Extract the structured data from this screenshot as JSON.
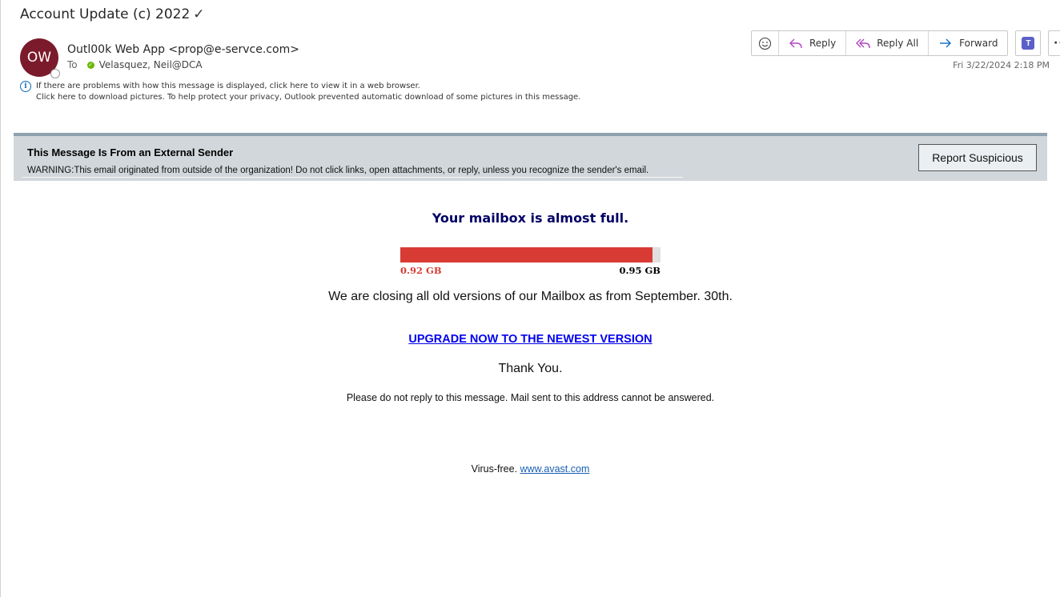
{
  "message": {
    "subject": "Account Update (c) 2022",
    "avatar_initials": "OW",
    "avatar_color": "#7a1a2b",
    "sender": "Outl00k Web App <prop@e-servce.com>",
    "to_label": "To",
    "recipient": "Velasquez, Neil@DCA",
    "datetime": "Fri 3/22/2024 2:18 PM",
    "info_line_1": "If there are problems with how this message is displayed, click here to view it in a web browser.",
    "info_line_2": "Click here to download pictures. To help protect your privacy, Outlook prevented automatic download of some pictures in this message."
  },
  "toolbar": {
    "emoji_icon": "smiley-icon",
    "reply_label": "Reply",
    "reply_all_label": "Reply All",
    "forward_label": "Forward",
    "teams_icon": "teams-icon",
    "more_icon": "more-icon"
  },
  "banner": {
    "title": "This Message Is From an External Sender",
    "text": "WARNING:This email originated from outside of the organization! Do not click links, open attachments, or reply, unless you recognize the sender's email.",
    "report_button": "Report Suspicious",
    "background_color": "#d1d7db"
  },
  "body": {
    "headline": "Your mailbox is almost full.",
    "usage": {
      "used_label": "0.92 GB",
      "total_label": "0.95 GB",
      "used_fraction": 0.9684,
      "fill_color": "#d83b34"
    },
    "closing_text": "We are closing all old versions of our Mailbox as from September. 30th.",
    "upgrade_link": "UPGRADE NOW TO THE NEWEST VERSION",
    "thanks": "Thank You.",
    "noreply": "Please do not reply to this message. Mail sent to this address cannot be answered.",
    "virus_prefix": "Virus-free. ",
    "virus_link": "www.avast.com"
  }
}
